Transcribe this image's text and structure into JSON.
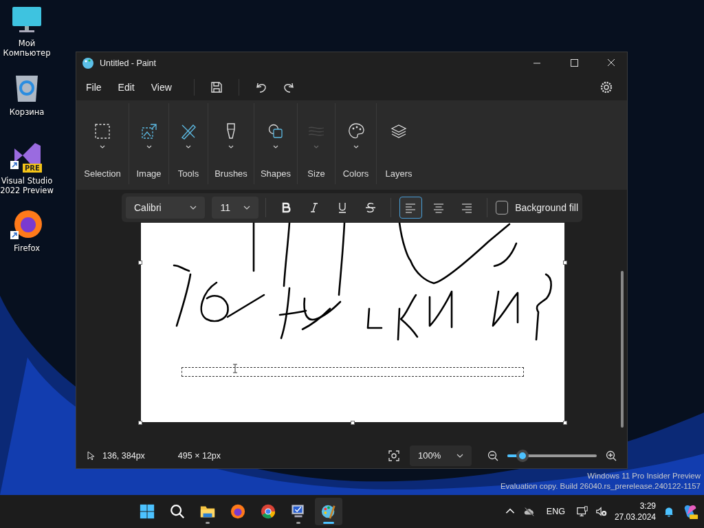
{
  "desktop_icons": [
    {
      "kind": "computer",
      "label": "Мой Компьютер"
    },
    {
      "kind": "recycle",
      "label": "Корзина"
    },
    {
      "kind": "vs",
      "label": "Visual Studio 2022 Preview",
      "badge": "PRE"
    },
    {
      "kind": "firefox",
      "label": "Firefox"
    }
  ],
  "window": {
    "title": "Untitled - Paint"
  },
  "menu": [
    "File",
    "Edit",
    "View"
  ],
  "ribbon": [
    {
      "kind": "selection",
      "label": "Selection",
      "dropdown": true,
      "disabled": false
    },
    {
      "kind": "image",
      "label": "Image",
      "dropdown": true,
      "disabled": false
    },
    {
      "kind": "tools",
      "label": "Tools",
      "dropdown": true,
      "disabled": false
    },
    {
      "kind": "brushes",
      "label": "Brushes",
      "dropdown": true,
      "disabled": false
    },
    {
      "kind": "shapes",
      "label": "Shapes",
      "dropdown": true,
      "disabled": false
    },
    {
      "kind": "size",
      "label": "Size",
      "dropdown": true,
      "disabled": true
    },
    {
      "kind": "colors",
      "label": "Colors",
      "dropdown": true,
      "disabled": false
    },
    {
      "kind": "layers",
      "label": "Layers",
      "dropdown": false,
      "disabled": false
    }
  ],
  "text_toolbar": {
    "font": "Calibri",
    "size": "11",
    "styles": [
      {
        "kind": "bold",
        "selected": false
      },
      {
        "kind": "italic",
        "selected": false
      },
      {
        "kind": "underline",
        "selected": false
      },
      {
        "kind": "strike",
        "selected": false
      }
    ],
    "align": [
      {
        "kind": "left",
        "selected": true
      },
      {
        "kind": "center",
        "selected": false
      },
      {
        "kind": "right",
        "selected": false
      }
    ],
    "background_fill": {
      "label": "Background fill",
      "checked": false
    }
  },
  "status_bar": {
    "cursor": "136, 384px",
    "selection": "495 × 12px",
    "zoom": "100%",
    "zoom_slider": {
      "level": 0.17
    }
  },
  "watermark_lines": [
    "Windows 11 Pro Insider Preview",
    "Evaluation copy. Build 26040.rs_prerelease.240122-1157"
  ],
  "taskbar": {
    "apps": [
      {
        "kind": "start",
        "running": false,
        "active": false
      },
      {
        "kind": "search",
        "running": false,
        "active": false
      },
      {
        "kind": "explorer",
        "running": true,
        "active": false
      },
      {
        "kind": "firefox",
        "running": false,
        "active": false
      },
      {
        "kind": "chrome",
        "running": false,
        "active": false
      },
      {
        "kind": "remote",
        "running": true,
        "active": false
      },
      {
        "kind": "paint",
        "running": true,
        "active": true
      }
    ],
    "language": "ENG",
    "time": "3:29",
    "date": "27.03.2024"
  }
}
